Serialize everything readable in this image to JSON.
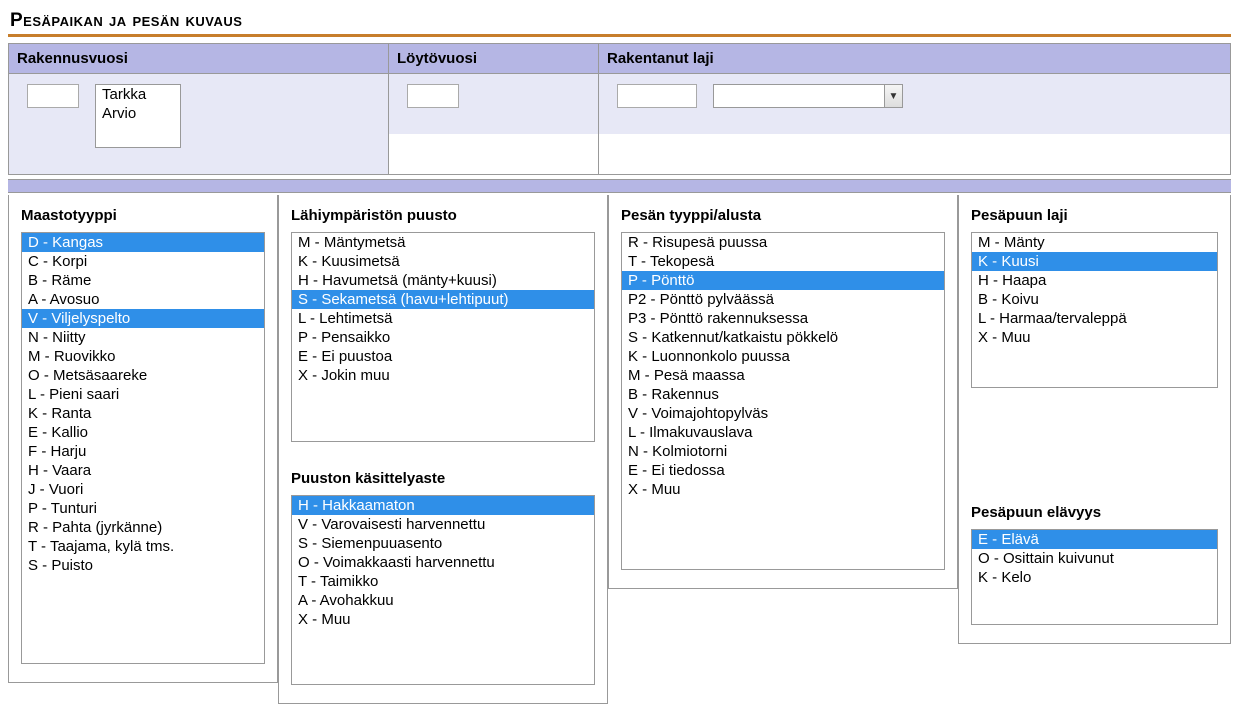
{
  "sectionTitle": "Pesäpaikan ja pesän kuvaus",
  "top": {
    "rakennusvuosi": {
      "label": "Rakennusvuosi",
      "value": "",
      "options": [
        "Tarkka",
        "Arvio"
      ]
    },
    "loytovuosi": {
      "label": "Löytövuosi",
      "value": ""
    },
    "rakentanutLaji": {
      "label": "Rakentanut laji",
      "code": "",
      "name": ""
    }
  },
  "maastotyyppi": {
    "label": "Maastotyyppi",
    "selected": [
      "D - Kangas",
      "V - Viljelyspelto"
    ],
    "options": [
      "D - Kangas",
      "C - Korpi",
      "B - Räme",
      "A - Avosuo",
      "V - Viljelyspelto",
      "N - Niitty",
      "M - Ruovikko",
      "O - Metsäsaareke",
      "L - Pieni saari",
      "K - Ranta",
      "E - Kallio",
      "F - Harju",
      "H - Vaara",
      "J - Vuori",
      "P - Tunturi",
      "R - Pahta (jyrkänne)",
      "T - Taajama, kylä tms.",
      "S - Puisto"
    ]
  },
  "puusto": {
    "label": "Lähiympäristön puusto",
    "selected": [
      "S - Sekametsä (havu+lehtipuut)"
    ],
    "options": [
      "M - Mäntymetsä",
      "K - Kuusimetsä",
      "H - Havumetsä (mänty+kuusi)",
      "S - Sekametsä (havu+lehtipuut)",
      "L - Lehtimetsä",
      "P - Pensaikko",
      "E - Ei puustoa",
      "X - Jokin muu"
    ]
  },
  "kasittely": {
    "label": "Puuston käsittelyaste",
    "selected": [
      "H - Hakkaamaton"
    ],
    "options": [
      "H - Hakkaamaton",
      "V - Varovaisesti harvennettu",
      "S - Siemenpuuasento",
      "O - Voimakkaasti harvennettu",
      "T - Taimikko",
      "A - Avohakkuu",
      "X - Muu"
    ]
  },
  "pesatyyppi": {
    "label": "Pesän tyyppi/alusta",
    "selected": [
      "P - Pönttö"
    ],
    "options": [
      "R - Risupesä puussa",
      "T - Tekopesä",
      "P - Pönttö",
      "P2 - Pönttö pylväässä",
      "P3 - Pönttö rakennuksessa",
      "S - Katkennut/katkaistu pökkelö",
      "K - Luonnonkolo puussa",
      "M - Pesä maassa",
      "B - Rakennus",
      "V - Voimajohtopylväs",
      "L - Ilmakuvauslava",
      "N - Kolmiotorni",
      "E - Ei tiedossa",
      "X - Muu"
    ]
  },
  "pesapuu": {
    "label": "Pesäpuun laji",
    "selected": [
      "K - Kuusi"
    ],
    "options": [
      "M - Mänty",
      "K - Kuusi",
      "H - Haapa",
      "B - Koivu",
      "L - Harmaa/tervaleppä",
      "X - Muu"
    ]
  },
  "elavyys": {
    "label": "Pesäpuun elävyys",
    "selected": [
      "E - Elävä"
    ],
    "options": [
      "E - Elävä",
      "O - Osittain kuivunut",
      "K - Kelo"
    ]
  }
}
